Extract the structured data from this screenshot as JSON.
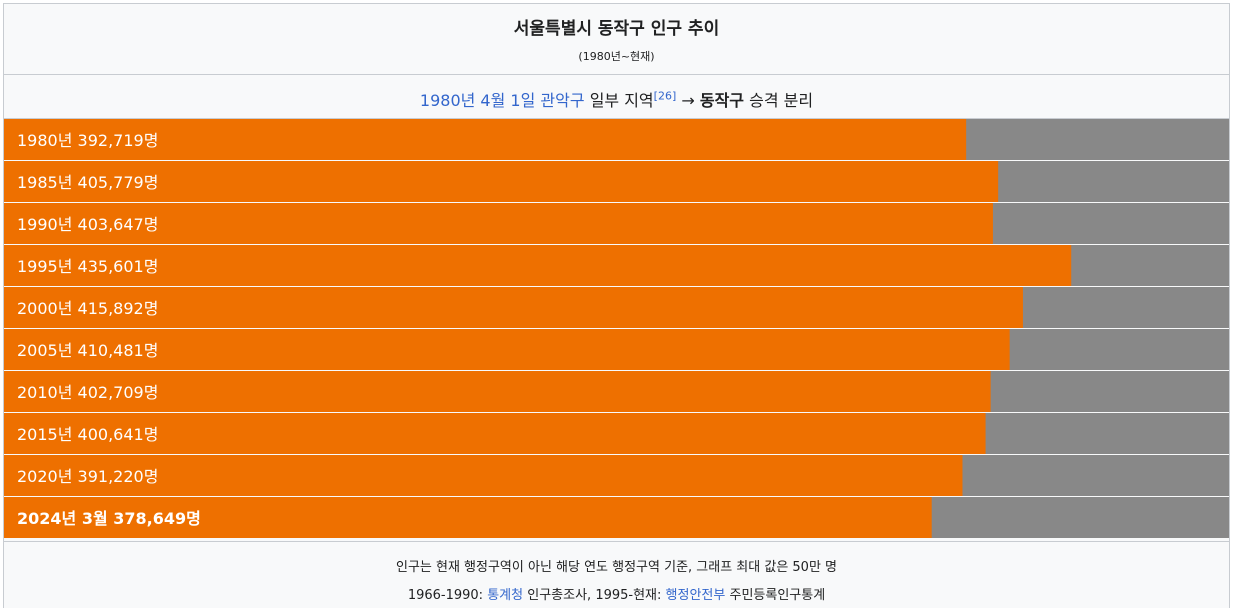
{
  "header": {
    "title": "서울특별시 동작구 인구 추이",
    "subtitle": "(1980년~현재)"
  },
  "note": {
    "date_link": "1980년 4월 1일",
    "from_link": "관악구",
    "text_mid": "일부 지역",
    "ref": "[26]",
    "arrow": "→",
    "to_bold": "동작구",
    "text_end": "승격 분리"
  },
  "footer": {
    "line1": "인구는 현재 행정구역이 아닌 해당 연도 행정구역 기준, 그래프 최대 값은 50만 명",
    "line2_prefix": "1966-1990:",
    "line2_link1": "통계청",
    "line2_mid": "인구총조사, 1995-현재:",
    "line2_link2": "행정안전부",
    "line2_suffix": "주민등록인구통계"
  },
  "colors": {
    "bar": "#ee7000",
    "remainder": "#888888",
    "label": "#ffffff"
  },
  "chart_data": {
    "type": "bar",
    "orientation": "horizontal",
    "title": "서울특별시 동작구 인구 추이",
    "subtitle": "(1980년~현재)",
    "xlim": [
      0,
      500000
    ],
    "categories": [
      "1980년",
      "1985년",
      "1990년",
      "1995년",
      "2000년",
      "2005년",
      "2010년",
      "2015년",
      "2020년",
      "2024년 3월"
    ],
    "values": [
      392719,
      405779,
      403647,
      435601,
      415892,
      410481,
      402709,
      400641,
      391220,
      378649
    ],
    "labels": [
      "1980년 392,719명",
      "1985년 405,779명",
      "1990년 403,647명",
      "1995년 435,601명",
      "2000년 415,892명",
      "2005년 410,481명",
      "2010년 402,709명",
      "2015년 400,641명",
      "2020년 391,220명",
      "2024년 3월 378,649명"
    ],
    "highlight_last": true
  }
}
